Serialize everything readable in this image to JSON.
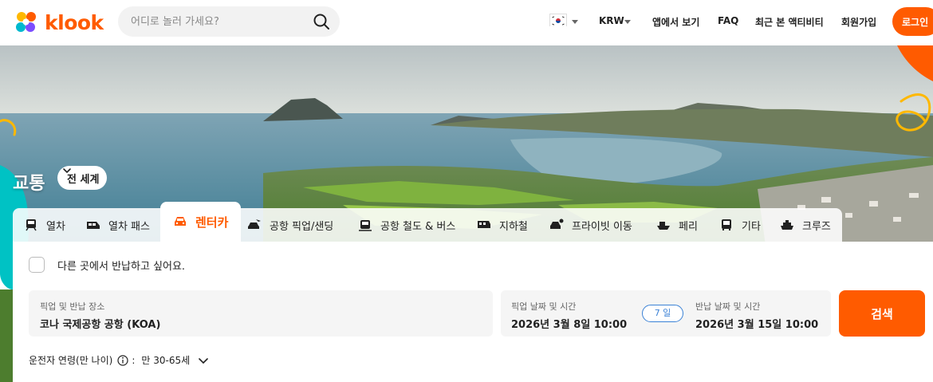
{
  "brand": {
    "name": "klook",
    "accent": "#ff5b00"
  },
  "header": {
    "search_placeholder": "어디로 놀러 가세요?",
    "currency": "KRW",
    "nav": [
      "앱에서 보기",
      "FAQ",
      "최근 본 액티비티",
      "회원가입"
    ],
    "login_label": "로그인"
  },
  "hero": {
    "title": "교통",
    "region_label": "전 세계"
  },
  "tabs": [
    {
      "label": "열차",
      "icon": "train-icon"
    },
    {
      "label": "열차 패스",
      "icon": "train-pass-icon"
    },
    {
      "label": "렌터카",
      "icon": "car-icon",
      "active": true
    },
    {
      "label": "공항 픽업/샌딩",
      "icon": "airport-transfer-icon"
    },
    {
      "label": "공항 철도 & 버스",
      "icon": "airport-bus-icon"
    },
    {
      "label": "지하철",
      "icon": "subway-icon"
    },
    {
      "label": "프라이빗 이동",
      "icon": "private-car-icon"
    },
    {
      "label": "페리",
      "icon": "ferry-icon"
    },
    {
      "label": "기타",
      "icon": "other-bus-icon"
    },
    {
      "label": "크루즈",
      "icon": "cruise-icon"
    }
  ],
  "form": {
    "return_elsewhere_label": "다른 곳에서 반납하고 싶어요.",
    "location": {
      "label": "픽업 및 반납 장소",
      "value": "코나 국제공항 공항 (KOA)"
    },
    "pickup": {
      "label": "픽업 날짜 및 시간",
      "value": "2026년 3월 8일 10:00"
    },
    "duration": "7 일",
    "dropoff": {
      "label": "반납 날짜 및 시간",
      "value": "2026년 3월 15일 10:00"
    },
    "search_label": "검색",
    "driver_age_label": "운전자 연령(만 나이)",
    "driver_age_value": "만 30-65세"
  }
}
